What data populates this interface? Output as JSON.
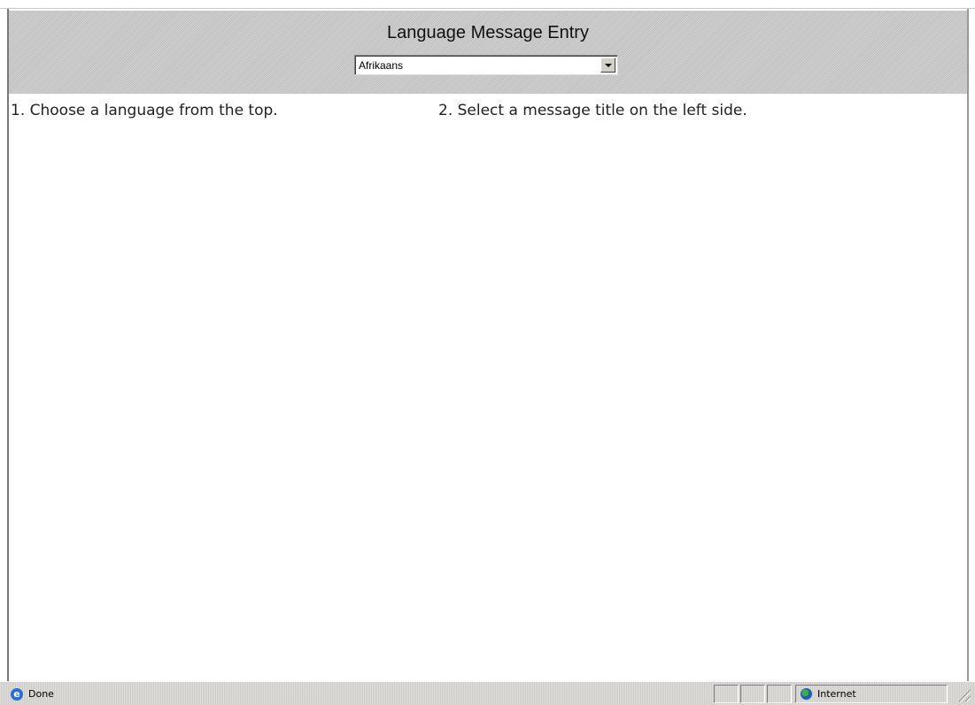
{
  "header": {
    "title": "Language Message Entry",
    "language_select": {
      "selected": "Afrikaans"
    }
  },
  "instructions": {
    "step1": "1. Choose a language from the top.",
    "step2": "2. Select a message title on the left side."
  },
  "statusbar": {
    "status": "Done",
    "zone": "Internet",
    "icons": {
      "page": "ie-page-icon",
      "zone": "globe-icon"
    }
  }
}
